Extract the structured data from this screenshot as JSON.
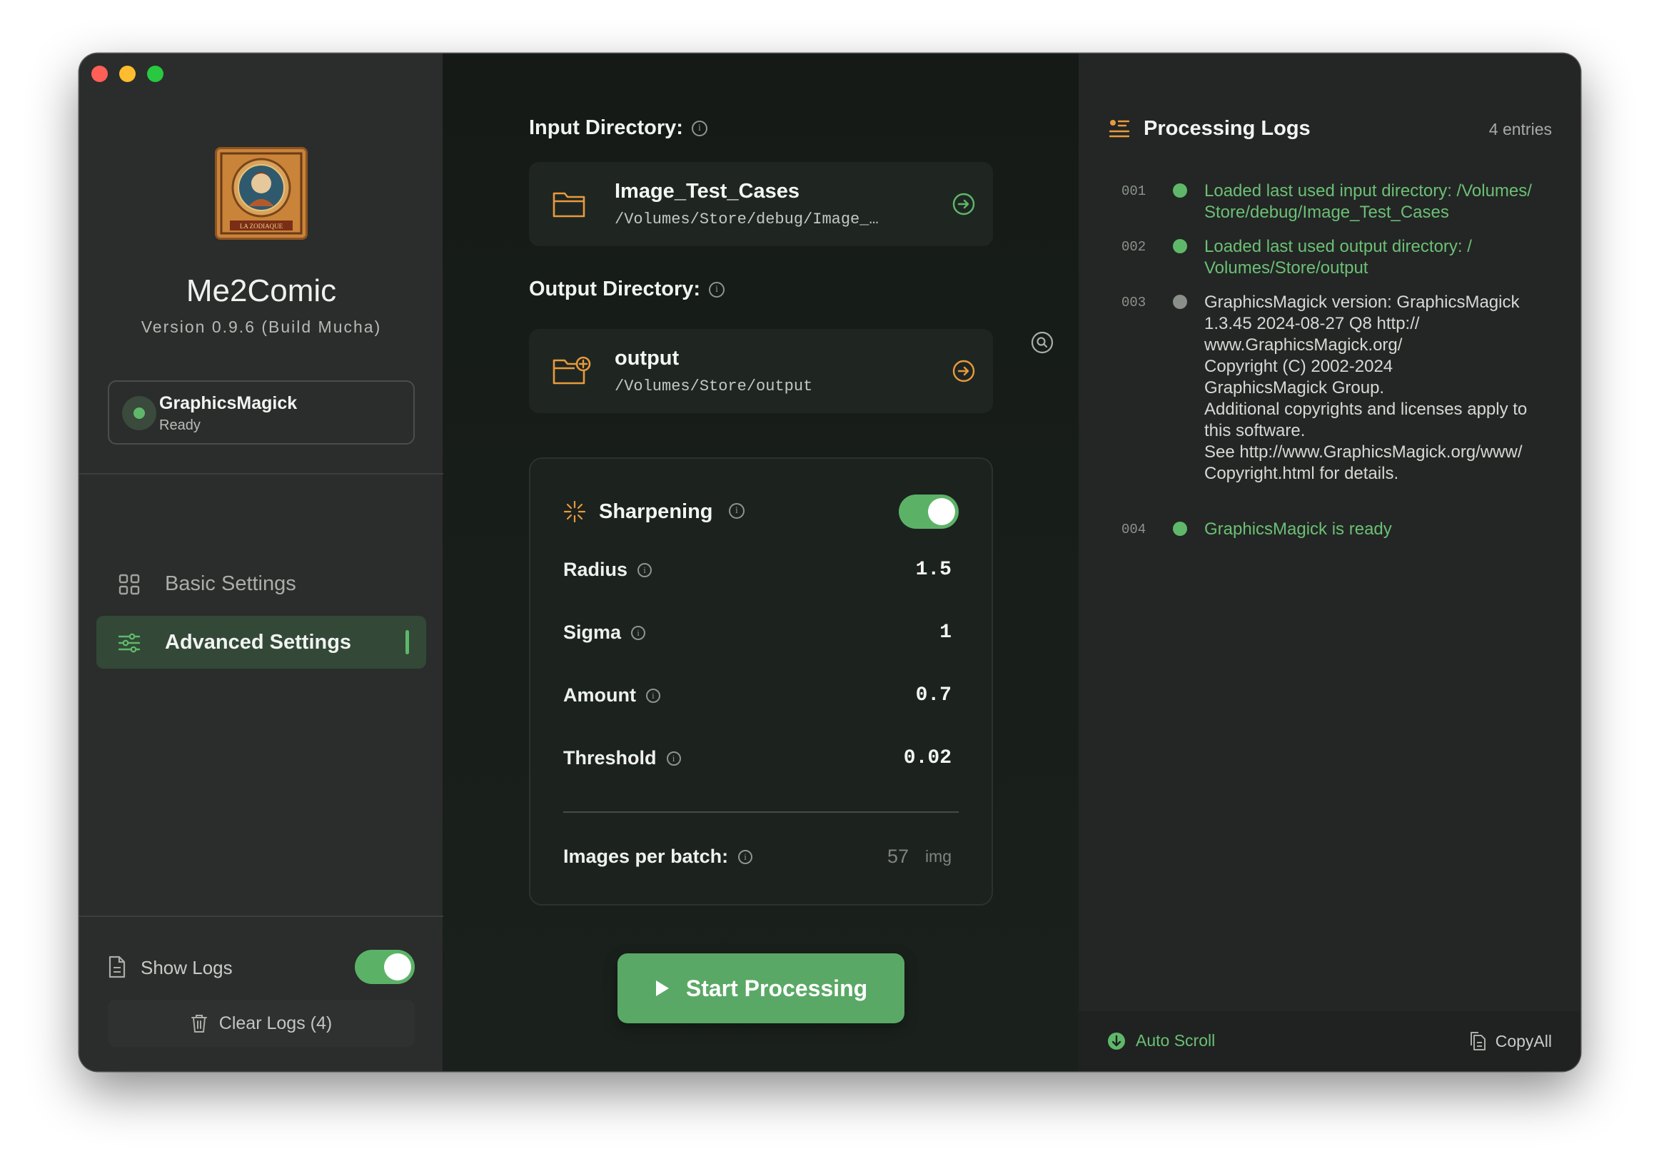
{
  "app": {
    "name": "Me2Comic",
    "version": "Version 0.9.6 (Build Mucha)",
    "logo_text": "LA ZODIAQUE"
  },
  "engine": {
    "name": "GraphicsMagick",
    "status": "Ready"
  },
  "sidebar": {
    "items": [
      {
        "label": "Basic Settings",
        "icon": "grid-icon",
        "active": false
      },
      {
        "label": "Advanced Settings",
        "icon": "sliders-icon",
        "active": true
      }
    ],
    "show_logs_label": "Show Logs",
    "show_logs_on": true,
    "clear_logs_label": "Clear Logs (4)"
  },
  "input_dir": {
    "label": "Input Directory:",
    "name": "Image_Test_Cases",
    "path": "/Volumes/Store/debug/Image_…"
  },
  "output_dir": {
    "label": "Output Directory:",
    "name": "output",
    "path": "/Volumes/Store/output"
  },
  "sharpening": {
    "title": "Sharpening",
    "enabled": true,
    "params": [
      {
        "label": "Radius",
        "value": "1.5"
      },
      {
        "label": "Sigma",
        "value": "1"
      },
      {
        "label": "Amount",
        "value": "0.7"
      },
      {
        "label": "Threshold",
        "value": "0.02"
      }
    ],
    "batch_label": "Images per batch:",
    "batch_value": "57",
    "batch_unit": "img"
  },
  "start_button": "Start Processing",
  "logs": {
    "title": "Processing Logs",
    "count": "4 entries",
    "entries": [
      {
        "num": "001",
        "type": "success",
        "text": "Loaded last used input directory: /Volumes/\nStore/debug/Image_Test_Cases"
      },
      {
        "num": "002",
        "type": "success",
        "text": "Loaded last used output directory: /\nVolumes/Store/output"
      },
      {
        "num": "003",
        "type": "info",
        "text": "GraphicsMagick version: GraphicsMagick\n1.3.45 2024-08-27 Q8 http://\nwww.GraphicsMagick.org/\nCopyright (C) 2002-2024\nGraphicsMagick Group.\nAdditional copyrights and licenses apply to\nthis software.\nSee http://www.GraphicsMagick.org/www/\nCopyright.html for details."
      },
      {
        "num": "004",
        "type": "success",
        "text": "GraphicsMagick is ready"
      }
    ],
    "auto_scroll_label": "Auto Scroll",
    "copy_all_label": "CopyAll"
  },
  "colors": {
    "accent_green": "#5fb86a",
    "folder_orange": "#e89a3c",
    "log_success": "#6cbf76"
  }
}
